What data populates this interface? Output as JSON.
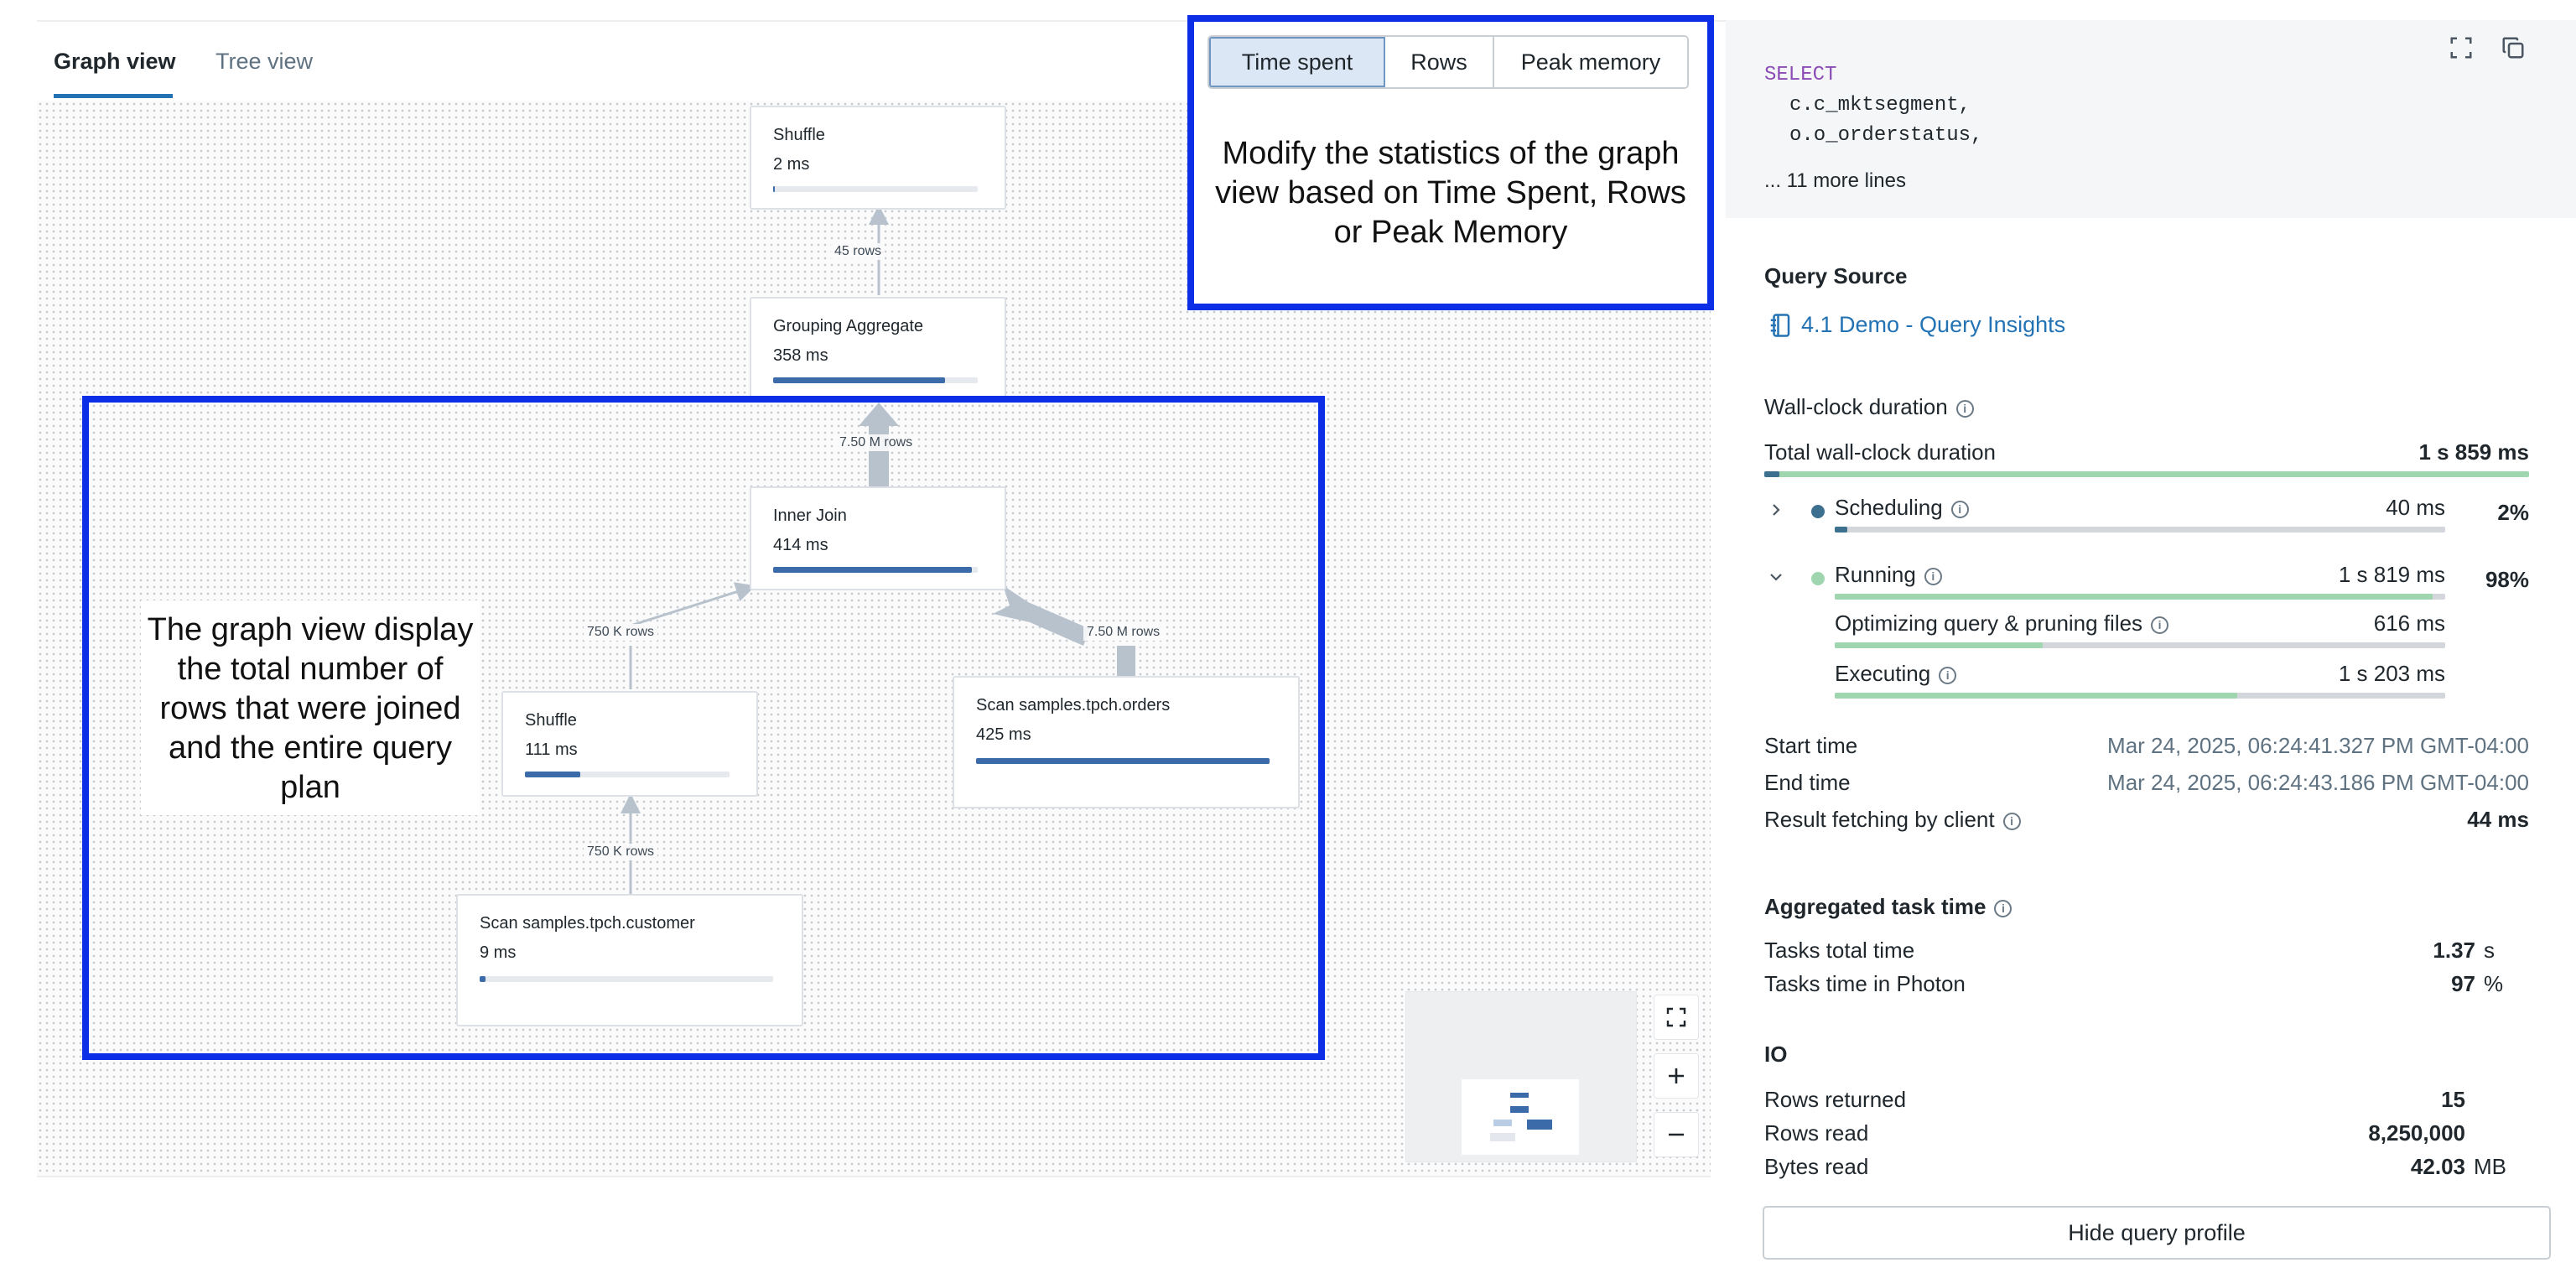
{
  "tabs": {
    "graph_view": "Graph view",
    "tree_view": "Tree view"
  },
  "stat_toggle": {
    "options": [
      "Time spent",
      "Rows",
      "Peak memory"
    ],
    "selected": "Time spent"
  },
  "graph": {
    "nodes": {
      "shuffle_top": {
        "name": "Shuffle",
        "time": "2 ms",
        "fraction": 0.01
      },
      "grouping_aggregate": {
        "name": "Grouping Aggregate",
        "time": "358 ms",
        "fraction": 0.84
      },
      "inner_join": {
        "name": "Inner Join",
        "time": "414 ms",
        "fraction": 0.97
      },
      "shuffle_left": {
        "name": "Shuffle",
        "time": "111 ms",
        "fraction": 0.27
      },
      "scan_orders": {
        "name": "Scan samples.tpch.orders",
        "time": "425 ms",
        "fraction": 1.0
      },
      "scan_customer": {
        "name": "Scan samples.tpch.customer",
        "time": "9 ms",
        "fraction": 0.02
      }
    },
    "edges": {
      "agg_to_shuffle": "45 rows",
      "join_to_agg": "7.50 M rows",
      "shuffle_to_join": "750 K rows",
      "orders_to_join": "7.50 M rows",
      "customer_to_shuffle": "750 K rows"
    }
  },
  "annotations": {
    "stats_note": "Modify the statistics of the graph view based on Time Spent, Rows or Peak Memory",
    "graph_note": "The graph view display the total number of rows that were joined and the entire query plan"
  },
  "sql": {
    "keyword": "SELECT",
    "line1": "c.c_mktsegment,",
    "line2": "o.o_orderstatus,",
    "more": "... 11 more lines"
  },
  "query_source": {
    "title": "Query Source",
    "link": "4.1 Demo - Query Insights"
  },
  "wall_clock": {
    "title": "Wall-clock duration",
    "total_label": "Total wall-clock duration",
    "total_value": "1 s 859 ms",
    "scheduling_label": "Scheduling",
    "scheduling_value": "40 ms",
    "scheduling_pct": "2%",
    "scheduling_fraction": 0.02,
    "running_label": "Running",
    "running_value": "1 s 819 ms",
    "running_pct": "98%",
    "running_fraction": 0.98,
    "optimizing_label": "Optimizing query & pruning files",
    "optimizing_value": "616 ms",
    "optimizing_fraction": 0.34,
    "executing_label": "Executing",
    "executing_value": "1 s 203 ms",
    "executing_fraction": 0.66
  },
  "times": {
    "start_label": "Start time",
    "start_value": "Mar 24, 2025, 06:24:41.327 PM GMT-04:00",
    "end_label": "End time",
    "end_value": "Mar 24, 2025, 06:24:43.186 PM GMT-04:00",
    "fetch_label": "Result fetching by client",
    "fetch_value": "44 ms"
  },
  "aggregated": {
    "title": "Aggregated task time",
    "total_label": "Tasks total time",
    "total_value": "1.37",
    "total_unit": "s",
    "photon_label": "Tasks time in Photon",
    "photon_value": "97",
    "photon_unit": "%"
  },
  "io": {
    "title": "IO",
    "rows_returned_label": "Rows returned",
    "rows_returned_value": "15",
    "rows_read_label": "Rows read",
    "rows_read_value": "8,250,000",
    "bytes_read_label": "Bytes read",
    "bytes_read_value": "42.03",
    "bytes_read_unit": "MB"
  },
  "hide_button": "Hide query profile",
  "colors": {
    "accent": "#2272b4",
    "node_bar": "#3b6ba9",
    "annotation_border": "#0b2ee6",
    "scheduling": "#3d6f8e",
    "running": "#9fd6b0"
  }
}
